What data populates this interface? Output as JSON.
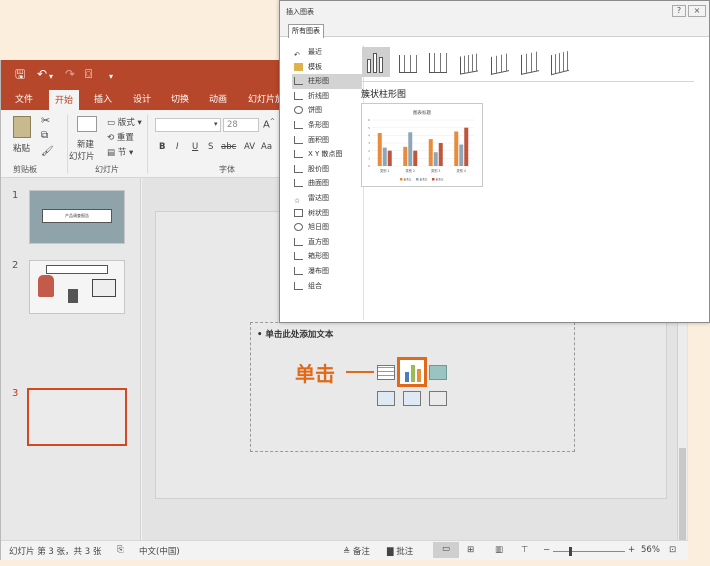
{
  "ppt": {
    "tabs": [
      "文件",
      "开始",
      "插入",
      "设计",
      "切换",
      "动画",
      "幻灯片放"
    ],
    "active_tab": "开始",
    "ribbon": {
      "paste": "粘贴",
      "clipboard_group": "剪贴板",
      "new_slide": "新建",
      "new_slide_2": "幻灯片",
      "layout": "版式",
      "reset": "重置",
      "section": "节",
      "slides_group": "幻灯片",
      "font_size": "28",
      "font_group": "字体",
      "format_buttons": [
        "B",
        "I",
        "U",
        "S",
        "abc",
        "AV",
        "Aa"
      ]
    },
    "slides": [
      {
        "number": "1",
        "text": "产品调查报告"
      },
      {
        "number": "2"
      },
      {
        "number": "3"
      }
    ],
    "placeholder_text": "单击此处添加文本",
    "click_annotation": "单击",
    "status": {
      "slide_info": "幻灯片 第 3 张，共 3 张",
      "language": "中文(中国)",
      "notes": "备注",
      "comments": "批注",
      "zoom": "56%"
    }
  },
  "dialog": {
    "title": "插入图表",
    "tab": "所有图表",
    "categories": [
      "最近",
      "模板",
      "柱形图",
      "折线图",
      "饼图",
      "条形图",
      "面积图",
      "X Y 散点图",
      "股价图",
      "曲面图",
      "雷达图",
      "树状图",
      "旭日图",
      "直方图",
      "箱形图",
      "瀑布图",
      "组合"
    ],
    "selected_category": "柱形图",
    "subtype_label": "簇状柱形图",
    "preview": {
      "title": "图表标题",
      "categories": [
        "类别 1",
        "类别 2",
        "类别 3",
        "类别 4"
      ],
      "legend": [
        "系列1",
        "系列2",
        "系列3"
      ]
    }
  },
  "chart_data": {
    "type": "bar",
    "title": "图表标题",
    "categories": [
      "类别 1",
      "类别 2",
      "类别 3",
      "类别 4"
    ],
    "series": [
      {
        "name": "系列1",
        "values": [
          4.3,
          2.5,
          3.5,
          4.5
        ]
      },
      {
        "name": "系列2",
        "values": [
          2.4,
          4.4,
          1.8,
          2.8
        ]
      },
      {
        "name": "系列3",
        "values": [
          2,
          2,
          3,
          5
        ]
      }
    ],
    "ylim": [
      0,
      6
    ],
    "colors": [
      "#e98b3a",
      "#8fa6b8",
      "#c0553b"
    ]
  },
  "colors": {
    "accent": "#b7472a",
    "highlight": "#e06a1a"
  }
}
